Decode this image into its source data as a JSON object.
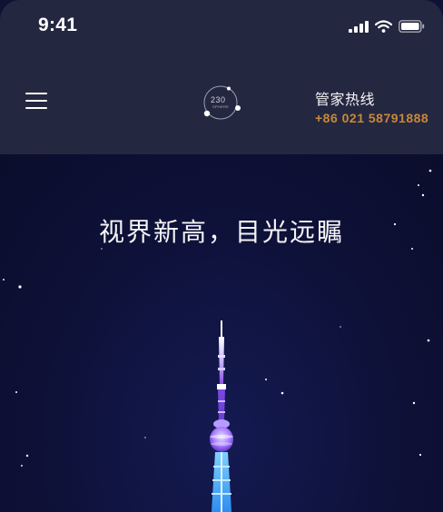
{
  "status_bar": {
    "time": "9:41",
    "icons": [
      "cellular-signal-icon",
      "wifi-icon",
      "battery-icon"
    ]
  },
  "header": {
    "menu_icon": "hamburger-menu-icon",
    "logo": {
      "number": "230",
      "sub": "SPHERE"
    },
    "hotline_label": "管家热线",
    "hotline_phone": "+86 021 58791888"
  },
  "hero": {
    "slogan": "视界新高，目光远瞩",
    "image": "tv-tower-at-night"
  },
  "colors": {
    "header_bg": "#242740",
    "hero_bg": "#0f1234",
    "accent_gold": "#c8883a",
    "tower_purple": "#8a4fe0",
    "tower_blue": "#3fa8ff"
  }
}
